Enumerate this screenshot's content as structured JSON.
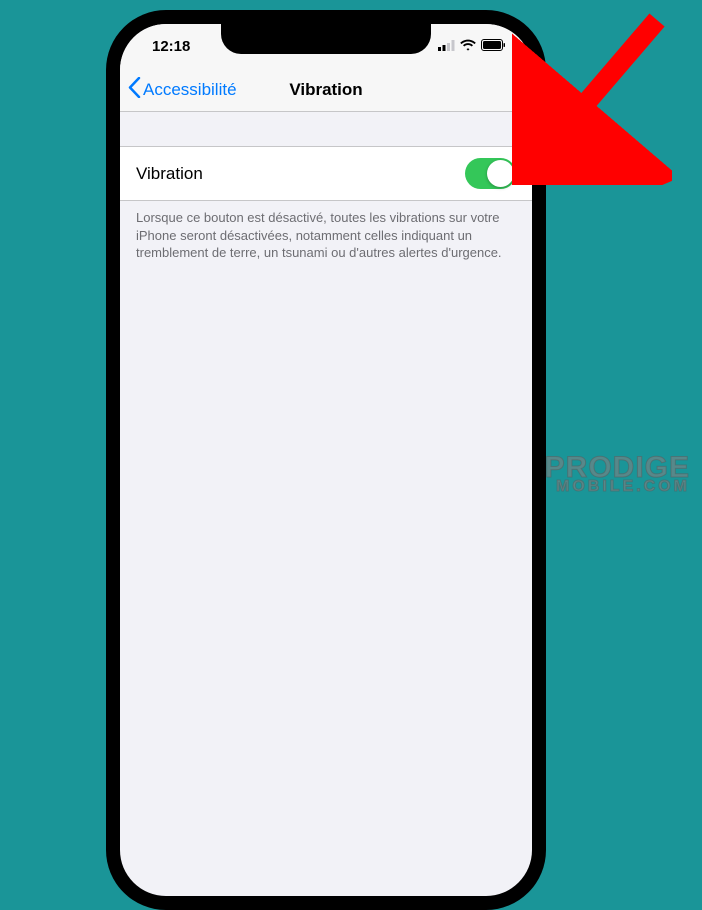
{
  "status": {
    "time": "12:18"
  },
  "nav": {
    "back_label": "Accessibilité",
    "title": "Vibration"
  },
  "setting": {
    "label": "Vibration",
    "enabled": true,
    "description": "Lorsque ce bouton est désactivé, toutes les vibrations sur votre iPhone seront désactivées, notamment celles indiquant un tremblement de terre, un tsunami ou d'autres alertes d'urgence."
  },
  "watermark": {
    "line1": "PRODIGE",
    "line2": "MOBILE.COM"
  },
  "colors": {
    "accent": "#007aff",
    "toggle_on": "#34c759",
    "arrow": "#ff0000"
  }
}
